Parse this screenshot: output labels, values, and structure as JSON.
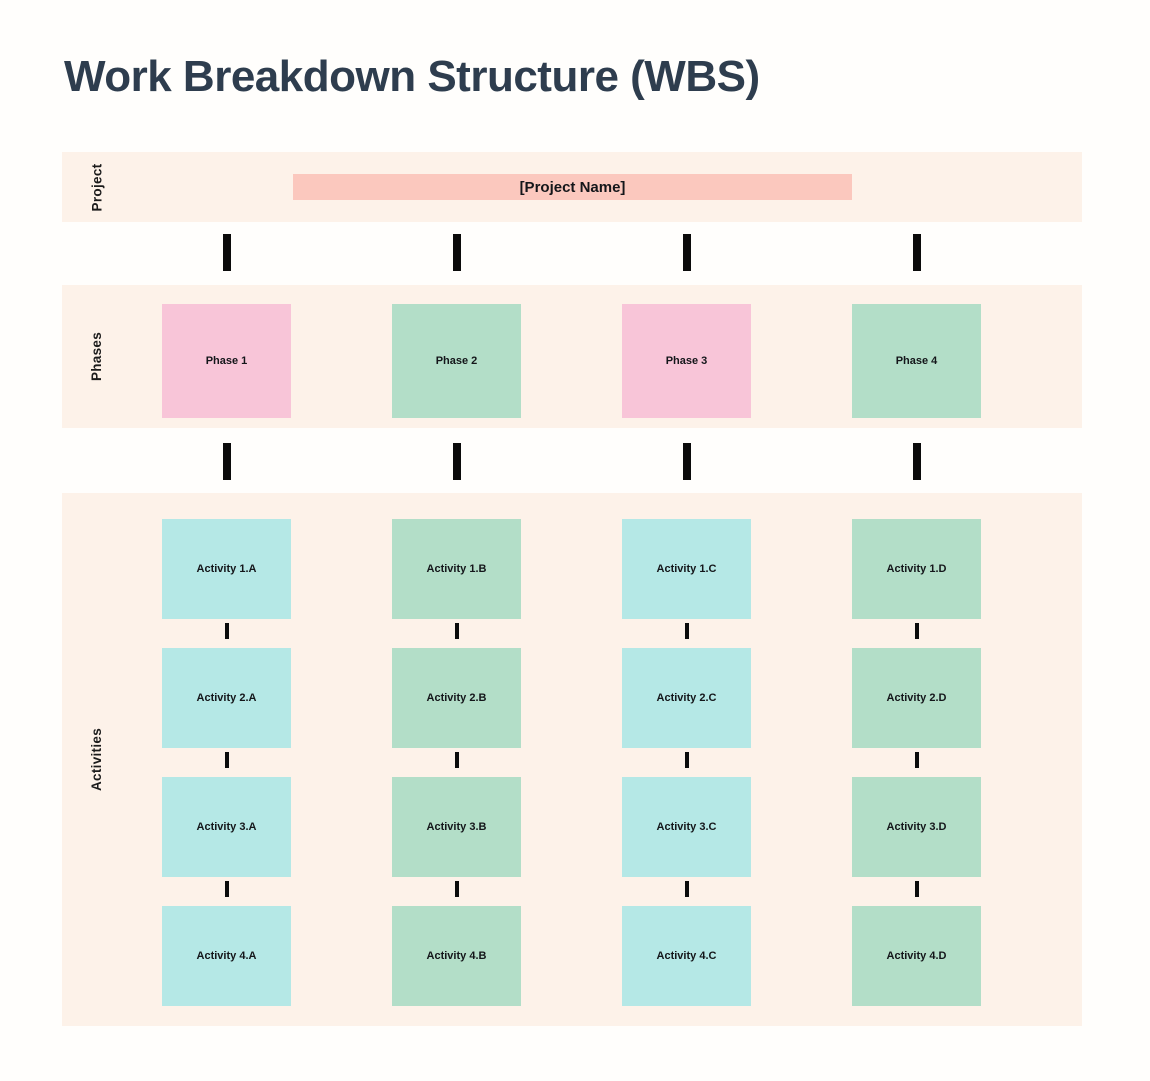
{
  "title": "Work Breakdown Structure (WBS)",
  "colors": {
    "page_background": "#FFFEFC",
    "panel_background": "#FDF2E9",
    "title_text": "#2E3D4E",
    "project_bar": "#FBC8BE",
    "phase_pink": "#F8C5D8",
    "phase_green": "#B3DEC8",
    "activity_cyan": "#B5E8E6",
    "activity_green": "#B3DEC8",
    "connector": "#0B0B0B"
  },
  "rows": {
    "project_label": "Project",
    "phases_label": "Phases",
    "activities_label": "Activities"
  },
  "project": {
    "name": "[Project Name]"
  },
  "phases": [
    {
      "label": "Phase 1",
      "color": "#F8C5D8"
    },
    {
      "label": "Phase 2",
      "color": "#B3DEC8"
    },
    {
      "label": "Phase 3",
      "color": "#F8C5D8"
    },
    {
      "label": "Phase 4",
      "color": "#B3DEC8"
    }
  ],
  "activities": {
    "columns": [
      "A",
      "B",
      "C",
      "D"
    ],
    "column_colors": [
      "#B5E8E6",
      "#B3DEC8",
      "#B5E8E6",
      "#B3DEC8"
    ],
    "rows": [
      [
        "Activity 1.A",
        "Activity 1.B",
        "Activity 1.C",
        "Activity 1.D"
      ],
      [
        "Activity 2.A",
        "Activity 2.B",
        "Activity 2.C",
        "Activity 2.D"
      ],
      [
        "Activity 3.A",
        "Activity 3.B",
        "Activity 3.C",
        "Activity 3.D"
      ],
      [
        "Activity 4.A",
        "Activity 4.B",
        "Activity 4.C",
        "Activity 4.D"
      ]
    ]
  }
}
